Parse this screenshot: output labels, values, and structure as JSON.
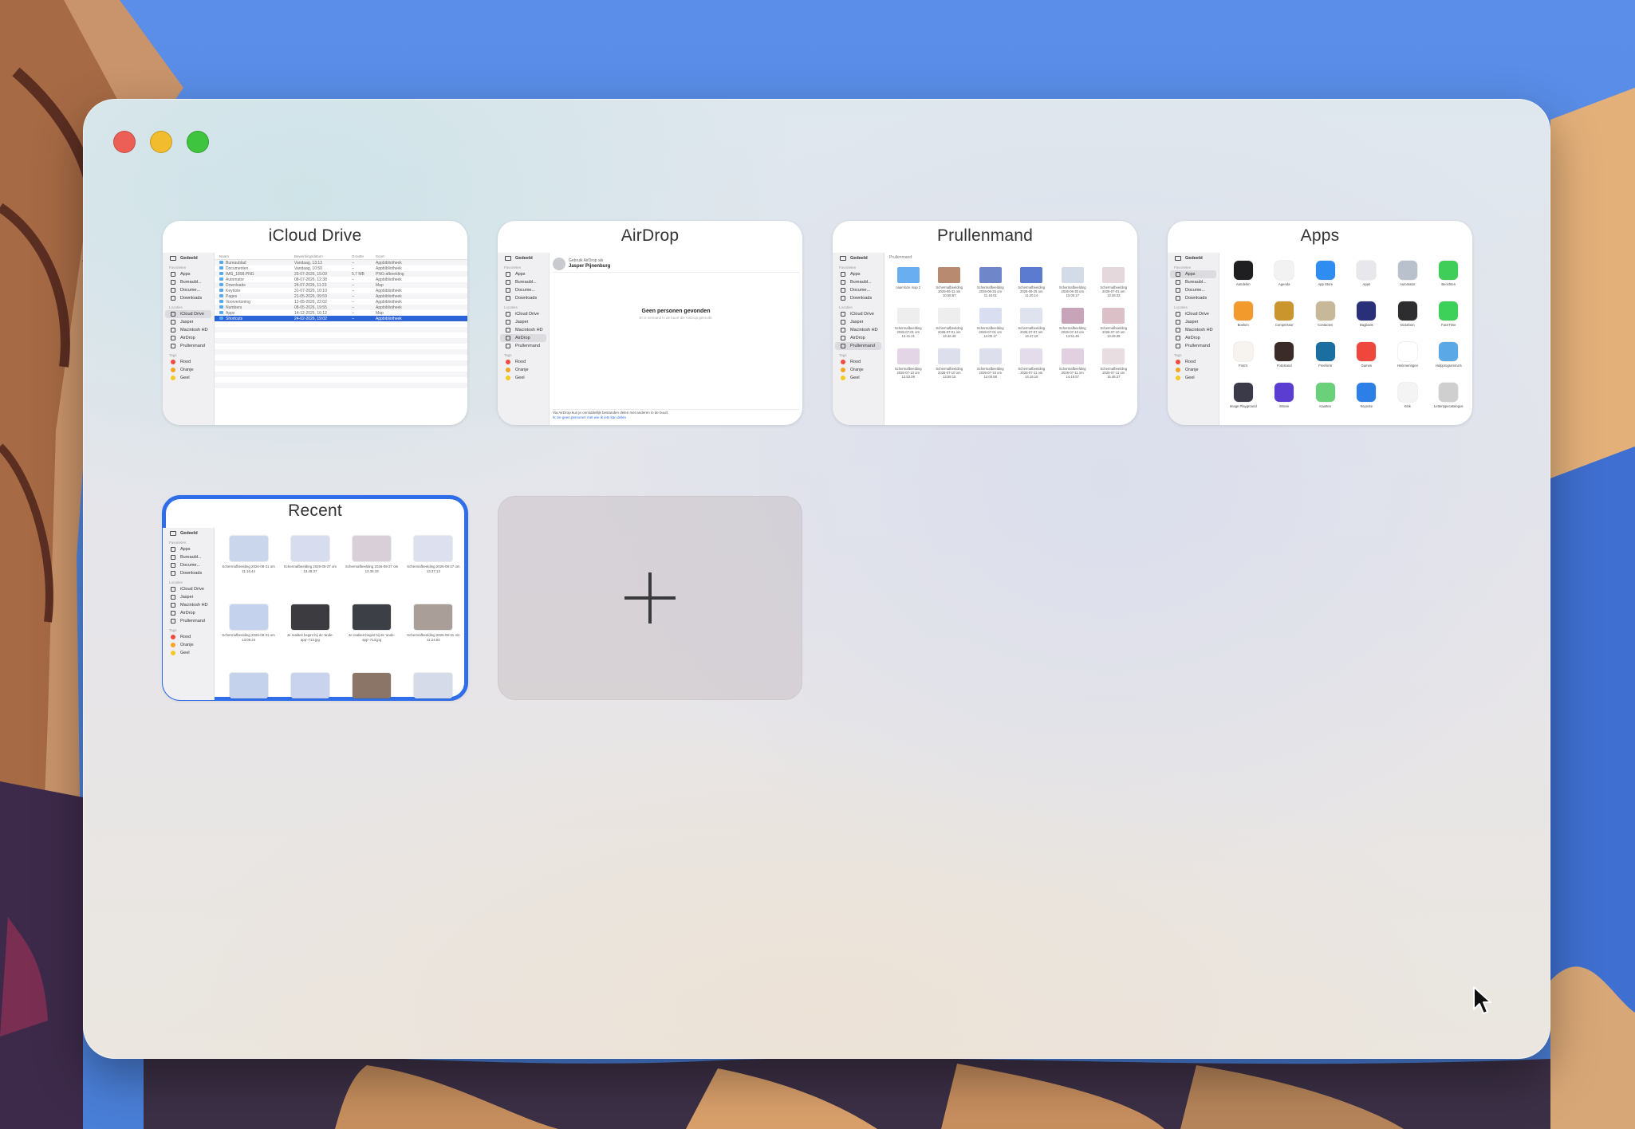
{
  "window": {
    "traffic_lights": [
      "close",
      "minimize",
      "zoom"
    ],
    "colors": {
      "close": "#ec5f57",
      "minimize": "#f1bc2e",
      "zoom": "#3fc43f",
      "selection": "#2f6ee8"
    }
  },
  "tiles": [
    {
      "title": "iCloud Drive",
      "selected": false
    },
    {
      "title": "AirDrop",
      "selected": false
    },
    {
      "title": "Prullenmand",
      "selected": false
    },
    {
      "title": "Apps",
      "selected": false
    },
    {
      "title": "Recent",
      "selected": true
    }
  ],
  "sidebar": {
    "top": "Gedeeld",
    "favorites_head": "Favorieten",
    "favorites": [
      "Apps",
      "Bureaubl...",
      "Docume...",
      "Downloads"
    ],
    "locations_head": "Locaties",
    "locations": [
      "iCloud Drive",
      "Jasper",
      "Macintosh HD",
      "AirDrop",
      "Prullenmand"
    ],
    "tags_head": "Tags",
    "tags": [
      "Rood",
      "Oranje",
      "Geel"
    ]
  },
  "icloud": {
    "columns": [
      "Naam",
      "Bewerkingsdatum",
      "Grootte",
      "Soort"
    ],
    "rows": [
      {
        "name": "Bureaublad",
        "date": "Vandaag, 13:13",
        "size": "--",
        "kind": "Appbibliotheek"
      },
      {
        "name": "Documenten",
        "date": "Vandaag, 10:50",
        "size": "--",
        "kind": "Appbibliotheek"
      },
      {
        "name": "IMG_1898.PNG",
        "date": "25-07-2026, 15:09",
        "size": "5,7 MB",
        "kind": "PNG-afbeelding"
      },
      {
        "name": "Automator",
        "date": "08-07-2026, 12:38",
        "size": "--",
        "kind": "Appbibliotheek"
      },
      {
        "name": "Downloads",
        "date": "24-07-2026, 11:23",
        "size": "--",
        "kind": "Map"
      },
      {
        "name": "Keynote",
        "date": "31-07-2026, 10:10",
        "size": "--",
        "kind": "Appbibliotheek"
      },
      {
        "name": "Pages",
        "date": "21-05-2026, 09:59",
        "size": "--",
        "kind": "Appbibliotheek"
      },
      {
        "name": "Voorvertoning",
        "date": "12-05-2026, 22:02",
        "size": "--",
        "kind": "Appbibliotheek"
      },
      {
        "name": "Numbers",
        "date": "08-05-2026, 19:55",
        "size": "--",
        "kind": "Appbibliotheek"
      },
      {
        "name": "Apps",
        "date": "14-12-2025, 16:12",
        "size": "--",
        "kind": "Map"
      },
      {
        "name": "Shortcuts",
        "date": "24-02-2026, 19:02",
        "size": "--",
        "kind": "Appbibliotheek"
      }
    ],
    "selected_row": 10
  },
  "airdrop": {
    "account_line": "Gebruik AirDrop als",
    "account_name": "Jasper Pijnenburg",
    "empty_title": "Geen personen gevonden",
    "empty_sub": "Er is niemand in de buurt die AirDrop gebruikt.",
    "footer_line": "Via AirDrop kun je onmiddellijk bestanden delen met anderen in de buurt.",
    "footer_link": "Ik zie geen personen met wie ik iets kan delen"
  },
  "trash": {
    "header": "Prullenmand",
    "items": [
      {
        "label": "naamloze map 2",
        "color": "#6aaef2"
      },
      {
        "label": "Schermafbeelding 2026-06-11 om 10.58.57",
        "color": "#b88a70"
      },
      {
        "label": "Schermafbeelding 2026-06-25 om 11.18.01",
        "color": "#6f86c9"
      },
      {
        "label": "Schermafbeelding 2026-06-25 om 11.20.14",
        "color": "#5a7bd0"
      },
      {
        "label": "Schermafbeelding 2026-06-30 om 13.00.17",
        "color": "#d3dbe8"
      },
      {
        "label": "Schermafbeelding 2026-07-01 om 13.28.33",
        "color": "#e5d8dc"
      },
      {
        "label": "Schermafbeelding 2026-07-01 om 13.41.21",
        "color": "#eeeeee"
      },
      {
        "label": "Schermafbeelding 2026-07-01 om 13.46.49",
        "color": "#eeeeee"
      },
      {
        "label": "Schermafbeelding 2026-07-01 om 14.00.17",
        "color": "#d9dff0"
      },
      {
        "label": "Schermafbeelding 2026-07-07 om 13.47.19",
        "color": "#dfe3ee"
      },
      {
        "label": "Schermafbeelding 2026-07-10 om 13.51.45",
        "color": "#c8a4b8"
      },
      {
        "label": "Schermafbeelding 2026-07-10 om 13.49.38",
        "color": "#dcc0c8"
      },
      {
        "label": "Schermafbeelding 2026-07-10 om 13.53.09",
        "color": "#e3d5e6"
      },
      {
        "label": "Schermafbeelding 2026-07-10 om 13.59.15",
        "color": "#dde0ec"
      },
      {
        "label": "Schermafbeelding 2026-07-10 om 14.00.58",
        "color": "#dde0ec"
      },
      {
        "label": "Schermafbeelding 2026-07-11 om 14.18.16",
        "color": "#e4dcea"
      },
      {
        "label": "Schermafbeelding 2026-07-11 om 14.19.57",
        "color": "#e0d0e0"
      },
      {
        "label": "Schermafbeelding 2026-07-11 om 15.46.27",
        "color": "#e8dde0"
      }
    ]
  },
  "apps": {
    "items": [
      {
        "label": "Aandelen",
        "color": "#1f1f22"
      },
      {
        "label": "Agenda",
        "color": "#f2f2f2"
      },
      {
        "label": "App Store",
        "color": "#2f8cf0"
      },
      {
        "label": "Apps",
        "color": "#e8e8ec"
      },
      {
        "label": "Automator",
        "color": "#b9c2cc"
      },
      {
        "label": "Berichten",
        "color": "#3fcf58"
      },
      {
        "label": "Boeken",
        "color": "#f39a2d"
      },
      {
        "label": "Compressor",
        "color": "#c9952c"
      },
      {
        "label": "Contacten",
        "color": "#c8b89a"
      },
      {
        "label": "Dagboek",
        "color": "#2a2f7a"
      },
      {
        "label": "Dictafoon",
        "color": "#2d2d30"
      },
      {
        "label": "FaceTime",
        "color": "#3ed15a"
      },
      {
        "label": "Foto's",
        "color": "#f7f3ee"
      },
      {
        "label": "Fotostand",
        "color": "#3a2a28"
      },
      {
        "label": "Freeform",
        "color": "#1a6fa0"
      },
      {
        "label": "Games",
        "color": "#f0473c"
      },
      {
        "label": "Herinneringen",
        "color": "#ffffff"
      },
      {
        "label": "Hulpprogramma's",
        "color": "#5aa8e6"
      },
      {
        "label": "Image Playground",
        "color": "#3a3a48"
      },
      {
        "label": "iMovie",
        "color": "#5b3dd1"
      },
      {
        "label": "Kaarten",
        "color": "#6ad07a"
      },
      {
        "label": "Keynote",
        "color": "#2d7fe8"
      },
      {
        "label": "Klok",
        "color": "#f4f4f4"
      },
      {
        "label": "Lettertypecatalogus",
        "color": "#cfcfcf"
      }
    ]
  },
  "recent": {
    "items": [
      {
        "label": "Schermafbeelding 2026-08-31 om 11.16.44",
        "color": "#c9d6ec"
      },
      {
        "label": "Schermafbeelding 2026-08-27 om 13.48.37",
        "color": "#d7dcef"
      },
      {
        "label": "Schermafbeelding 2026-08-27 om 13.38.18",
        "color": "#d8cfd8"
      },
      {
        "label": "Schermafbeelding 2026-08-27 om 13.37.13",
        "color": "#dde0ee"
      },
      {
        "label": "Schermafbeelding 2026-08-31 om 13.08.24",
        "color": "#c5d2ee"
      },
      {
        "label": "Je realiteit begint bij de 'ande-app'-713.jpg",
        "color": "#3b3b40"
      },
      {
        "label": "Je realiteit begint bij de 'ande-app'-713.jpg",
        "color": "#3c3f46"
      },
      {
        "label": "Schermafbeelding 2026-08-31 om 11.24.54",
        "color": "#a99f98"
      },
      {
        "label": "",
        "color": "#c4d2ec"
      },
      {
        "label": "",
        "color": "#c9d3ee"
      },
      {
        "label": "",
        "color": "#8a7566"
      },
      {
        "label": "",
        "color": "#d5dbe9"
      }
    ]
  },
  "new_tab": {
    "icon": "plus-icon"
  },
  "cursor": {
    "icon": "pointer-icon"
  }
}
